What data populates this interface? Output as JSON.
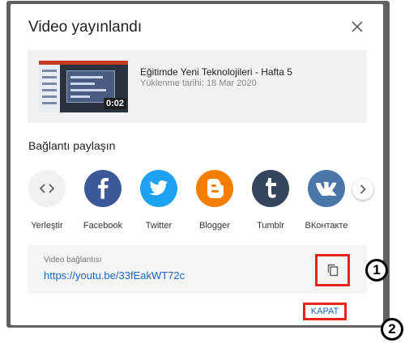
{
  "dialog": {
    "title": "Video yayınlandı",
    "close_icon": "close-icon"
  },
  "video": {
    "title": "Eğitimde Yeni Teknolojileri - Hafta 5",
    "upload_date": "Yüklenme tarihi: 18 Mar 2020",
    "duration": "0:02"
  },
  "share": {
    "label": "Bağlantı paylaşın",
    "items": [
      {
        "label": "Yerleştir",
        "icon": "embed-icon",
        "color": "#f1f1f1"
      },
      {
        "label": "Facebook",
        "icon": "facebook-icon",
        "color": "#3b5998"
      },
      {
        "label": "Twitter",
        "icon": "twitter-icon",
        "color": "#1da1f2"
      },
      {
        "label": "Blogger",
        "icon": "blogger-icon",
        "color": "#f57d00"
      },
      {
        "label": "Tumblr",
        "icon": "tumblr-icon",
        "color": "#35465c"
      },
      {
        "label": "ВКонтакте",
        "icon": "vk-icon",
        "color": "#4a76a8"
      }
    ],
    "next_icon": "chevron-right-icon"
  },
  "link": {
    "label": "Video bağlantısı",
    "url": "https://youtu.be/33fEakWT72c",
    "copy_icon": "copy-icon"
  },
  "actions": {
    "close_label": "KAPAT"
  },
  "annotations": {
    "callout_1": "1",
    "callout_2": "2",
    "highlight_color": "#e8231b"
  }
}
